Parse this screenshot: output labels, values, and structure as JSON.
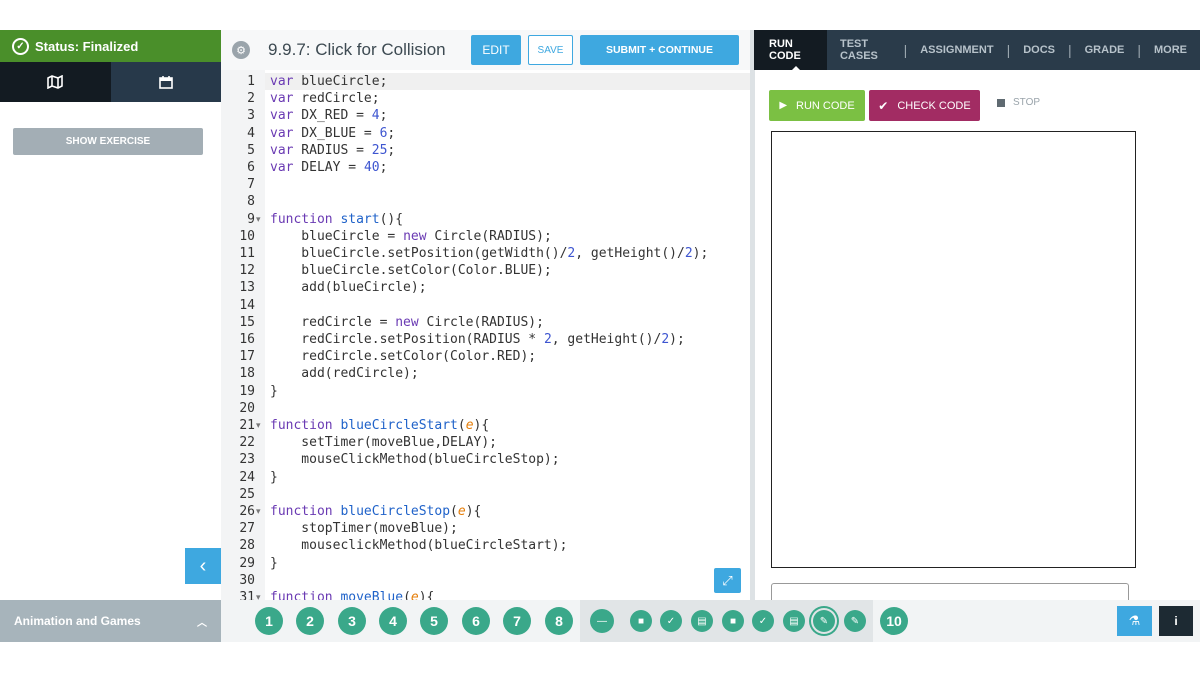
{
  "status": {
    "label": "Status: Finalized"
  },
  "sidebar": {
    "tabs": [
      {
        "icon": "map-icon"
      },
      {
        "icon": "calendar-icon"
      }
    ],
    "show_exercise": "SHOW EXERCISE"
  },
  "unit": {
    "name": "Animation and Games"
  },
  "toolbar": {
    "title": "9.9.7: Click for Collision",
    "edit": "EDIT",
    "save": "SAVE",
    "submit": "SUBMIT + CONTINUE"
  },
  "editor": {
    "lines": [
      "var blueCircle;",
      "var redCircle;",
      "var DX_RED = 4;",
      "var DX_BLUE = 6;",
      "var RADIUS = 25;",
      "var DELAY = 40;",
      "",
      "",
      "function start(){",
      "    blueCircle = new Circle(RADIUS);",
      "    blueCircle.setPosition(getWidth()/2, getHeight()/2);",
      "    blueCircle.setColor(Color.BLUE);",
      "    add(blueCircle);",
      "",
      "    redCircle = new Circle(RADIUS);",
      "    redCircle.setPosition(RADIUS * 2, getHeight()/2);",
      "    redCircle.setColor(Color.RED);",
      "    add(redCircle);",
      "}",
      "",
      "function blueCircleStart(e){",
      "    setTimer(moveBlue,DELAY);",
      "    mouseClickMethod(blueCircleStop);",
      "}",
      "",
      "function blueCircleStop(e){",
      "    stopTimer(moveBlue);",
      "    mouseclickMethod(blueCircleStart);",
      "}",
      "",
      "function moveBlue(e){"
    ]
  },
  "right_tabs": [
    "RUN CODE",
    "TEST CASES",
    "ASSIGNMENT",
    "DOCS",
    "GRADE",
    "MORE"
  ],
  "run": {
    "run": "RUN CODE",
    "check": "CHECK CODE",
    "stop": "STOP"
  },
  "steps": [
    "1",
    "2",
    "3",
    "4",
    "5",
    "6",
    "7",
    "8",
    "10"
  ],
  "sub_steps": [
    "minus-icon",
    "video-icon",
    "check-icon",
    "document-icon",
    "video-icon",
    "check-icon",
    "document-icon",
    "pencil-icon",
    "pencil-icon"
  ],
  "colors": {
    "accent": "#3ea8e0",
    "status_green": "#4a8f2a",
    "run_green": "#7bc043",
    "check_magenta": "#a22c63",
    "step_teal": "#3aa88a",
    "dark_nav": "#2a3b4a"
  }
}
